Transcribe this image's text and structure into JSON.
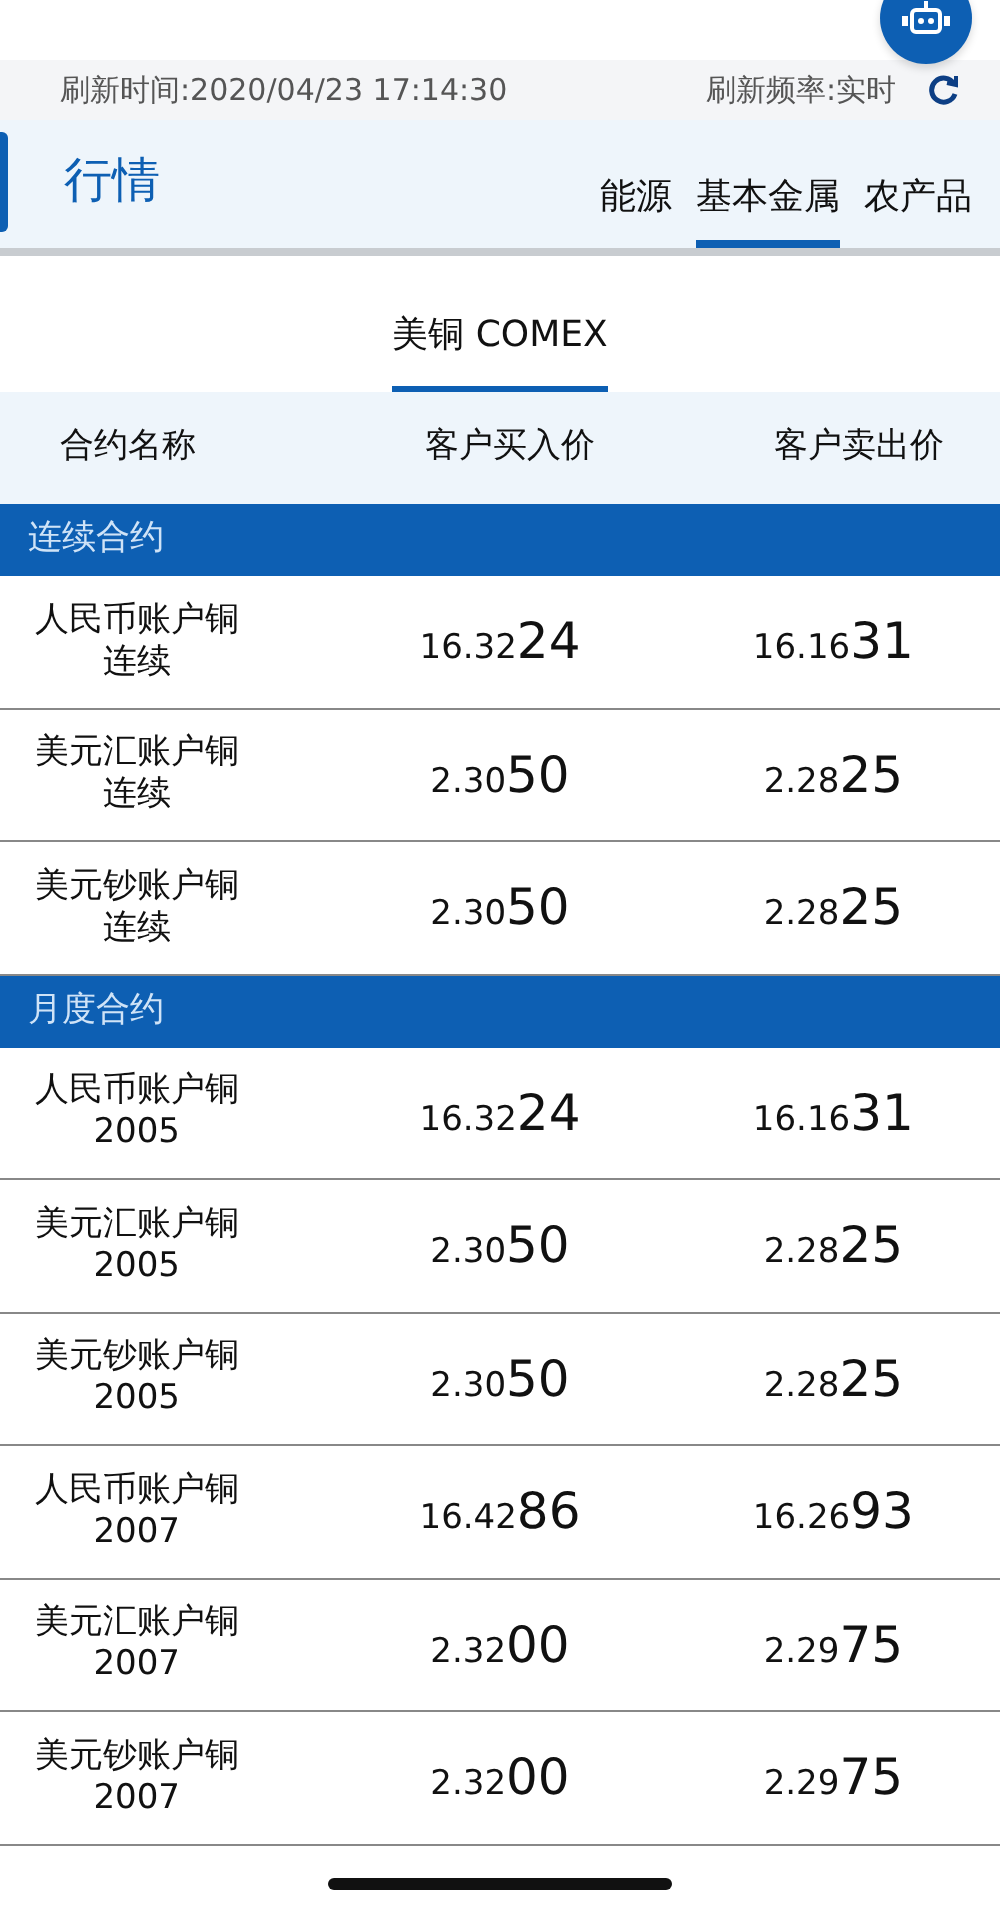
{
  "refresh_bar": {
    "time": "刷新时间:2020/04/23 17:14:30",
    "frequency": "刷新频率:实时"
  },
  "header": {
    "title": "行情",
    "tabs": [
      {
        "label": "能源",
        "selected": false
      },
      {
        "label": "基本金属",
        "selected": true
      },
      {
        "label": "农产品",
        "selected": false
      }
    ]
  },
  "sub_tabs": [
    {
      "label": "美铜 COMEX",
      "selected": true
    }
  ],
  "table": {
    "columns": [
      "合约名称",
      "客户买入价",
      "客户卖出价"
    ],
    "sections": [
      {
        "title": "连续合约",
        "rows": [
          {
            "name": "人民币账户铜",
            "term": "连续",
            "buy": "16.3224",
            "sell": "16.1631"
          },
          {
            "name": "美元汇账户铜",
            "term": "连续",
            "buy": "2.3050",
            "sell": "2.2825"
          },
          {
            "name": "美元钞账户铜",
            "term": "连续",
            "buy": "2.3050",
            "sell": "2.2825"
          }
        ]
      },
      {
        "title": "月度合约",
        "rows": [
          {
            "name": "人民币账户铜",
            "term": "2005",
            "buy": "16.3224",
            "sell": "16.1631"
          },
          {
            "name": "美元汇账户铜",
            "term": "2005",
            "buy": "2.3050",
            "sell": "2.2825"
          },
          {
            "name": "美元钞账户铜",
            "term": "2005",
            "buy": "2.3050",
            "sell": "2.2825"
          },
          {
            "name": "人民币账户铜",
            "term": "2007",
            "buy": "16.4286",
            "sell": "16.2693"
          },
          {
            "name": "美元汇账户铜",
            "term": "2007",
            "buy": "2.3200",
            "sell": "2.2975"
          },
          {
            "name": "美元钞账户铜",
            "term": "2007",
            "buy": "2.3200",
            "sell": "2.2975"
          }
        ]
      }
    ]
  }
}
